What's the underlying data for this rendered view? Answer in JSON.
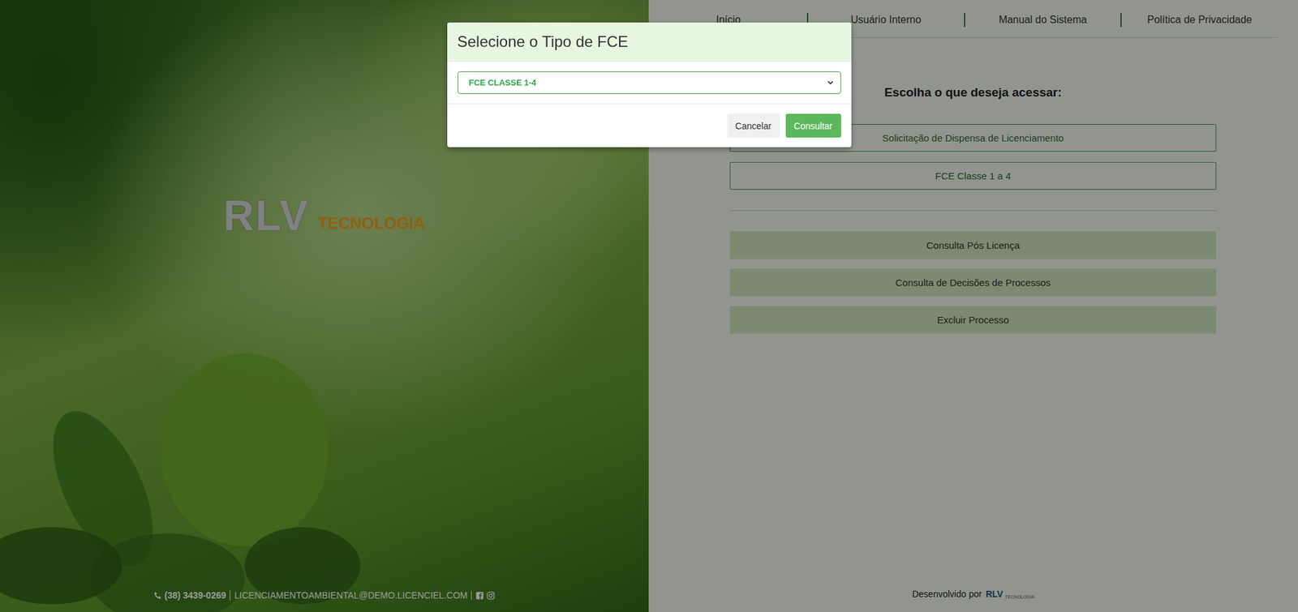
{
  "left_panel": {
    "logo": {
      "mark": "RLV",
      "subtitle": "TECNOLOGIA"
    },
    "contact": {
      "phone": "(38) 3439-0269",
      "email": "LICENCIAMENTOAMBIENTAL@DEMO.LICENCIEL.COM"
    }
  },
  "nav": [
    "Início",
    "Usuário Interno",
    "Manual do Sistema",
    "Política de Privacidade"
  ],
  "heading": "Escolha o que deseja acessar:",
  "primary_buttons": [
    "Solicitação de Dispensa de Licenciamento",
    "FCE Classe 1 a 4"
  ],
  "secondary_buttons": [
    "Consulta Pós Licença",
    "Consulta de Decisões de Processos",
    "Excluir Processo"
  ],
  "footer": {
    "text": "Desenvolvido por",
    "logo": {
      "mark": "RLV",
      "subtitle": "TECNOLOGIA"
    }
  },
  "modal": {
    "title": "Selecione o Tipo de FCE",
    "select": {
      "value": "FCE CLASSE 1-4"
    },
    "buttons": [
      {
        "label": "Cancelar",
        "kind": "secondary"
      },
      {
        "label": "Consultar",
        "kind": "primary"
      }
    ]
  }
}
